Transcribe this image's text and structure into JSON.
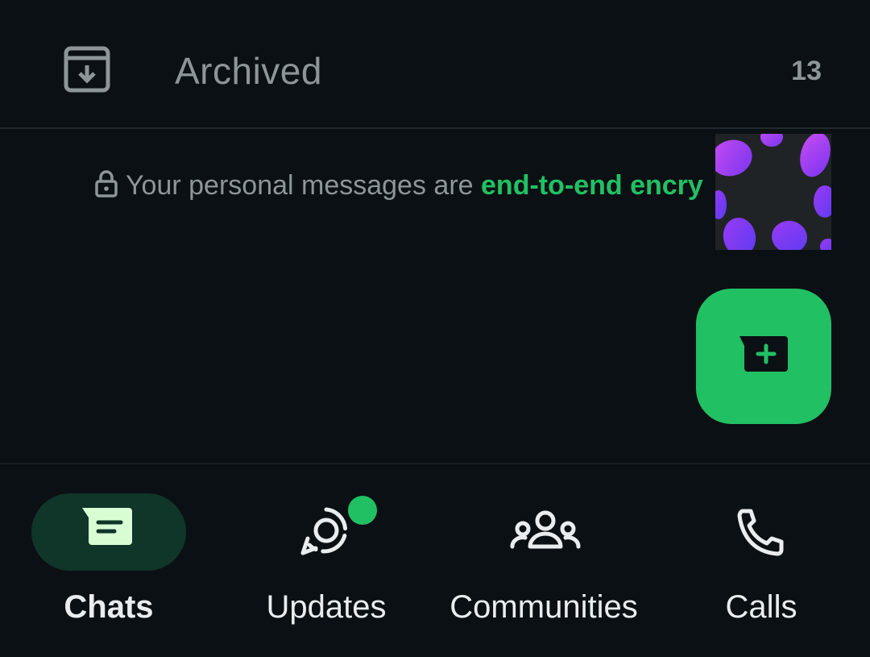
{
  "archived": {
    "label": "Archived",
    "count": "13",
    "icon": "archive-icon"
  },
  "encryption": {
    "text": "Your personal messages are ",
    "link": "end-to-end encry",
    "icon": "lock-icon"
  },
  "fab": {
    "icon": "new-chat-icon"
  },
  "nav": {
    "items": [
      {
        "label": "Chats",
        "icon": "chats-icon",
        "active": true
      },
      {
        "label": "Updates",
        "icon": "status-icon",
        "active": false,
        "badge": true
      },
      {
        "label": "Communities",
        "icon": "communities-icon",
        "active": false
      },
      {
        "label": "Calls",
        "icon": "phone-icon",
        "active": false
      }
    ]
  },
  "colors": {
    "background": "#0b1014",
    "accent": "#21c063",
    "active_pill": "#103529",
    "muted_text": "#8d9599",
    "primary_text": "#e9edef"
  }
}
